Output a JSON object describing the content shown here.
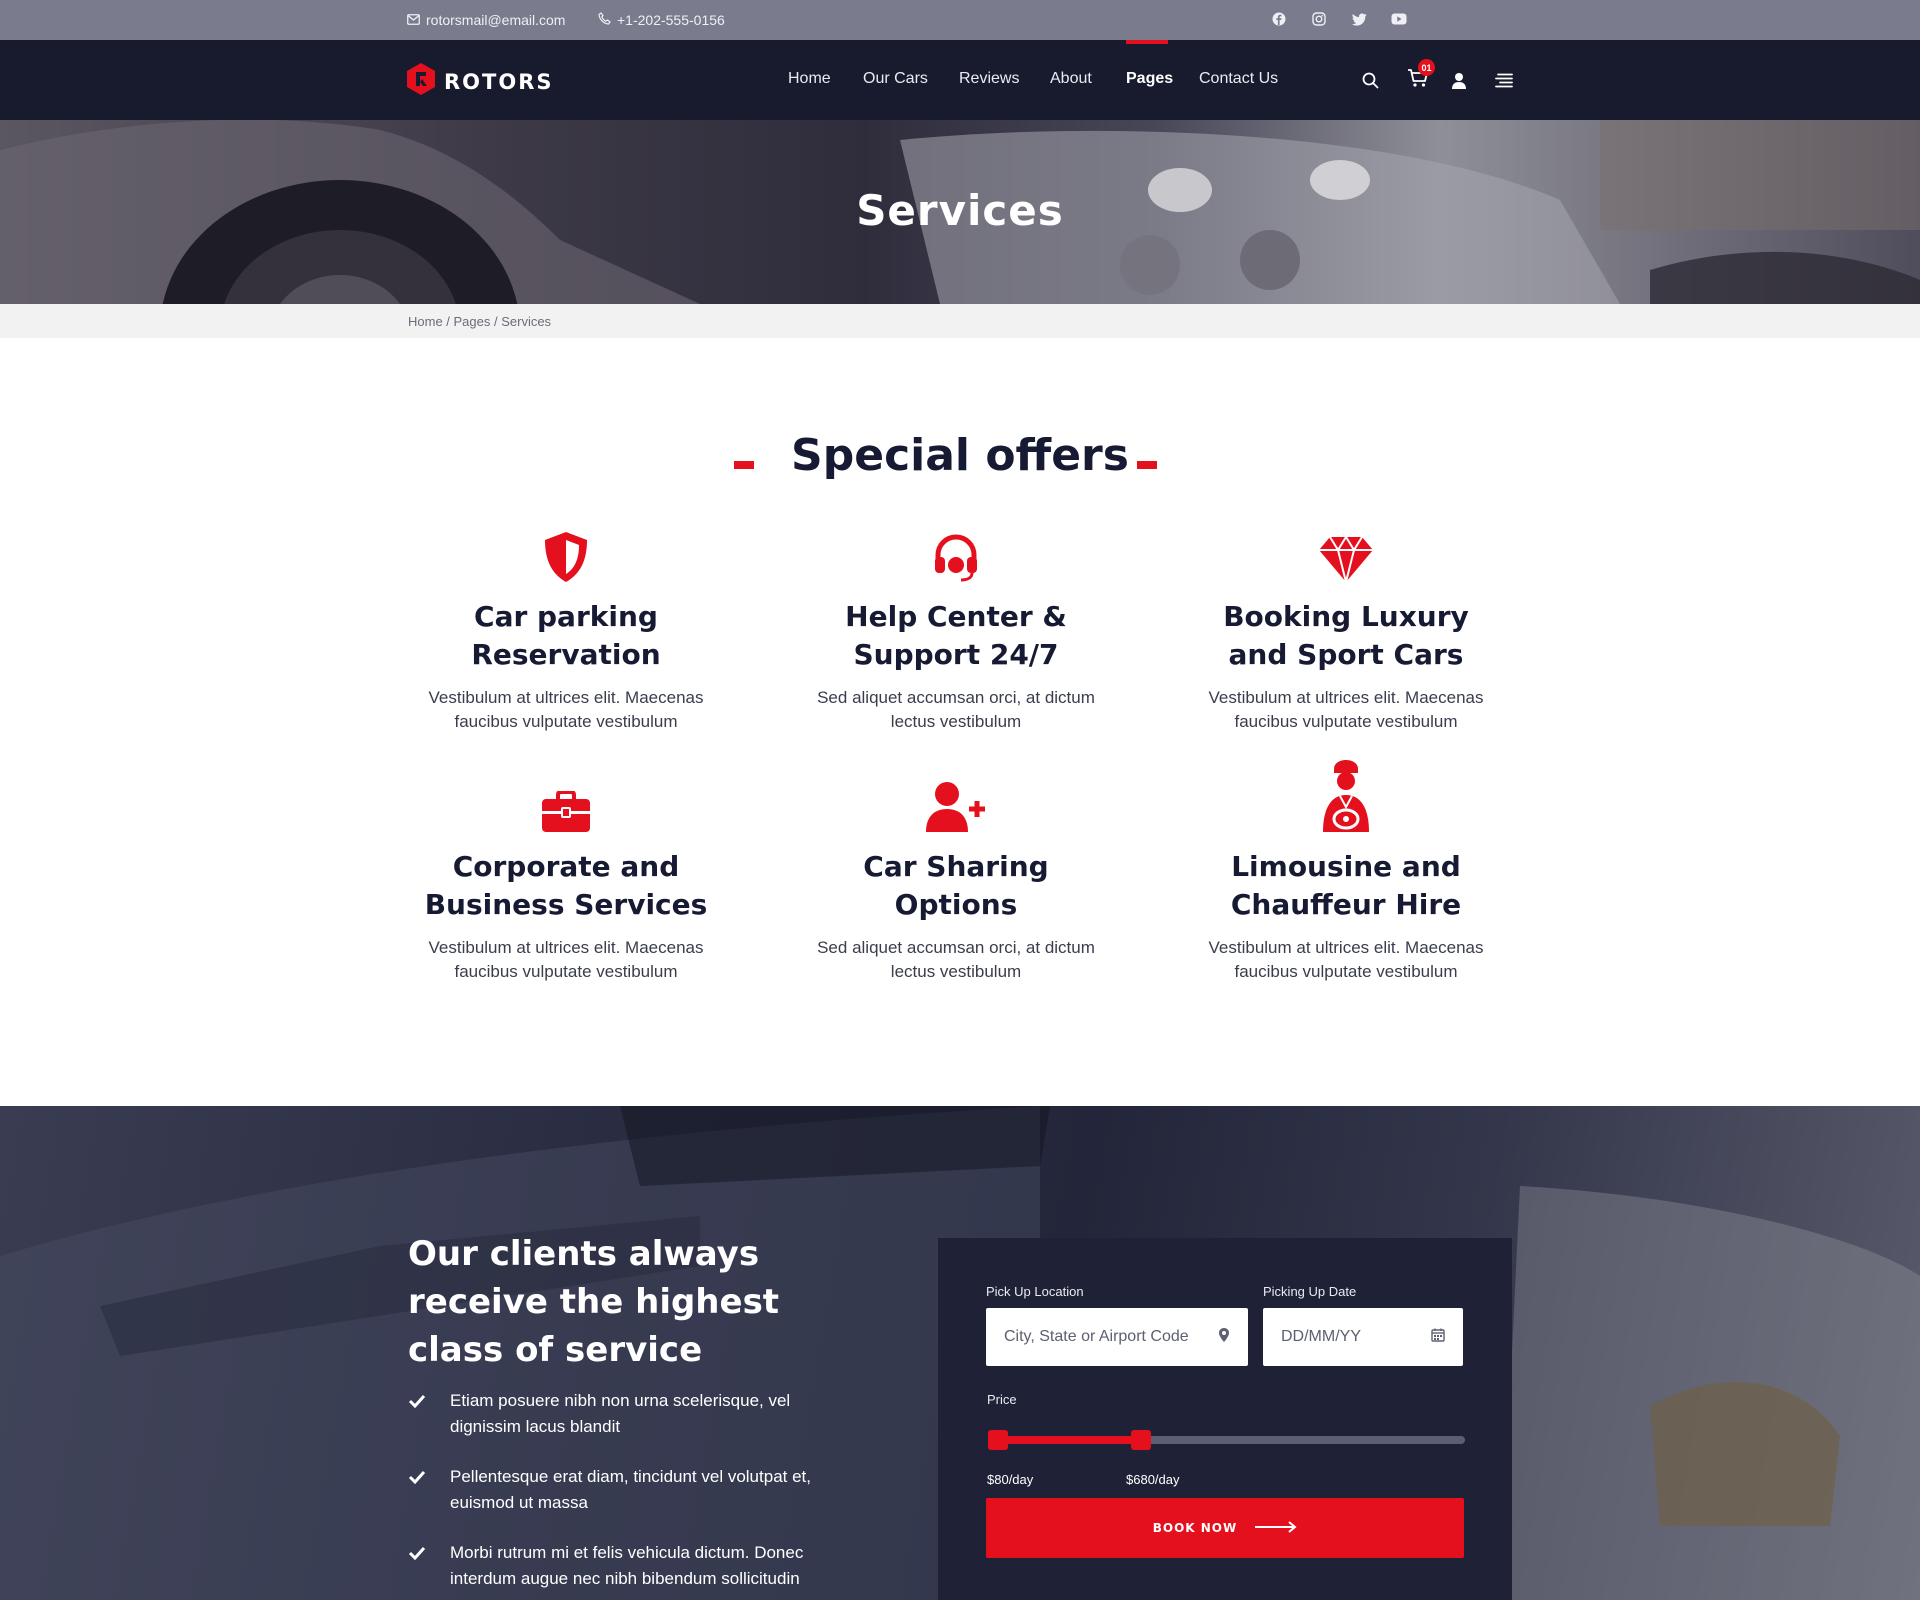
{
  "topbar": {
    "email": "rotorsmail@email.com",
    "phone": "+1-202-555-0156",
    "social_icons": [
      "facebook-icon",
      "instagram-icon",
      "twitter-icon",
      "youtube-icon"
    ]
  },
  "brand": {
    "name": "ROTORS",
    "accent": "#e5101e",
    "navy": "#171a33"
  },
  "nav": {
    "items": [
      {
        "label": "Home"
      },
      {
        "label": "Our Cars"
      },
      {
        "label": "Reviews"
      },
      {
        "label": "About"
      },
      {
        "label": "Pages",
        "active": true
      },
      {
        "label": "Contact Us"
      }
    ],
    "cart_count": "01",
    "icons": [
      "search-icon",
      "cart-icon",
      "user-icon",
      "menu-icon"
    ]
  },
  "hero": {
    "title": "Services"
  },
  "breadcrumb": "Home / Pages / Services",
  "offers": {
    "title": "Special offers",
    "items": [
      {
        "icon": "shield-icon",
        "title_1": "Car parking",
        "title_2": "Reservation",
        "text_1": "Vestibulum at ultrices elit. Maecenas",
        "text_2": "faucibus vulputate vestibulum"
      },
      {
        "icon": "headset-icon",
        "title_1": "Help Center &",
        "title_2": "Support 24/7",
        "text_1": "Sed aliquet accumsan orci, at dictum",
        "text_2": "lectus vestibulum"
      },
      {
        "icon": "diamond-icon",
        "title_1": "Booking Luxury",
        "title_2": "and Sport Cars",
        "text_1": "Vestibulum at ultrices elit. Maecenas",
        "text_2": "faucibus vulputate vestibulum"
      },
      {
        "icon": "briefcase-icon",
        "title_1": "Corporate and",
        "title_2": "Business Services",
        "text_1": "Vestibulum at ultrices elit. Maecenas",
        "text_2": "faucibus vulputate vestibulum"
      },
      {
        "icon": "user-plus-icon",
        "title_1": "Car Sharing",
        "title_2": "Options",
        "text_1": "Sed aliquet accumsan orci, at dictum",
        "text_2": "lectus vestibulum"
      },
      {
        "icon": "chauffeur-icon",
        "title_1": "Limousine and",
        "title_2": "Chauffeur Hire",
        "text_1": "Vestibulum at ultrices elit. Maecenas",
        "text_2": "faucibus vulputate vestibulum"
      }
    ]
  },
  "booking": {
    "heading_1": "Our clients always",
    "heading_2": "receive the highest",
    "heading_3": "class of service",
    "bullets": [
      {
        "line_1": "Etiam posuere nibh non urna scelerisque, vel",
        "line_2": "dignissim lacus blandit"
      },
      {
        "line_1": "Pellentesque erat diam, tincidunt vel volutpat et,",
        "line_2": "euismod ut massa"
      },
      {
        "line_1": "Morbi rutrum mi et felis vehicula dictum. Donec",
        "line_2": "interdum augue nec nibh bibendum sollicitudin"
      }
    ],
    "form": {
      "pickup_label": "Pick Up Location",
      "pickup_placeholder": "City, State or Airport Code",
      "date_label": "Picking Up Date",
      "date_placeholder": "DD/MM/YY",
      "price_label": "Price",
      "price_min": "$80/day",
      "price_max": "$680/day",
      "price_range_fraction": [
        0,
        0.32
      ],
      "button_label": "BOOK NOW"
    }
  }
}
